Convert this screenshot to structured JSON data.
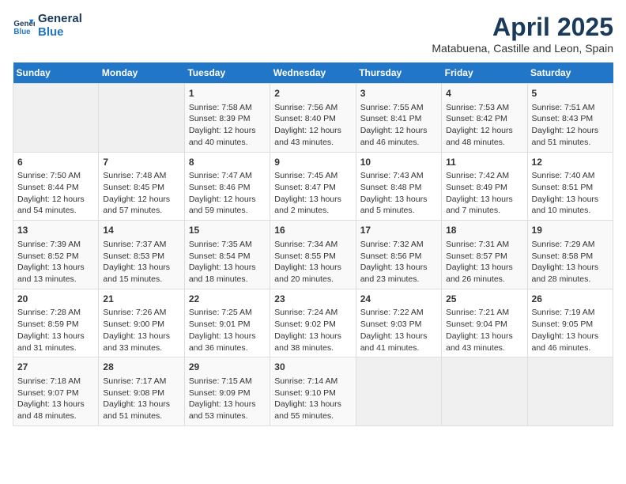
{
  "logo": {
    "line1": "General",
    "line2": "Blue"
  },
  "title": "April 2025",
  "subtitle": "Matabuena, Castille and Leon, Spain",
  "days_of_week": [
    "Sunday",
    "Monday",
    "Tuesday",
    "Wednesday",
    "Thursday",
    "Friday",
    "Saturday"
  ],
  "weeks": [
    [
      {
        "day": "",
        "info": ""
      },
      {
        "day": "",
        "info": ""
      },
      {
        "day": "1",
        "info": "Sunrise: 7:58 AM\nSunset: 8:39 PM\nDaylight: 12 hours and 40 minutes."
      },
      {
        "day": "2",
        "info": "Sunrise: 7:56 AM\nSunset: 8:40 PM\nDaylight: 12 hours and 43 minutes."
      },
      {
        "day": "3",
        "info": "Sunrise: 7:55 AM\nSunset: 8:41 PM\nDaylight: 12 hours and 46 minutes."
      },
      {
        "day": "4",
        "info": "Sunrise: 7:53 AM\nSunset: 8:42 PM\nDaylight: 12 hours and 48 minutes."
      },
      {
        "day": "5",
        "info": "Sunrise: 7:51 AM\nSunset: 8:43 PM\nDaylight: 12 hours and 51 minutes."
      }
    ],
    [
      {
        "day": "6",
        "info": "Sunrise: 7:50 AM\nSunset: 8:44 PM\nDaylight: 12 hours and 54 minutes."
      },
      {
        "day": "7",
        "info": "Sunrise: 7:48 AM\nSunset: 8:45 PM\nDaylight: 12 hours and 57 minutes."
      },
      {
        "day": "8",
        "info": "Sunrise: 7:47 AM\nSunset: 8:46 PM\nDaylight: 12 hours and 59 minutes."
      },
      {
        "day": "9",
        "info": "Sunrise: 7:45 AM\nSunset: 8:47 PM\nDaylight: 13 hours and 2 minutes."
      },
      {
        "day": "10",
        "info": "Sunrise: 7:43 AM\nSunset: 8:48 PM\nDaylight: 13 hours and 5 minutes."
      },
      {
        "day": "11",
        "info": "Sunrise: 7:42 AM\nSunset: 8:49 PM\nDaylight: 13 hours and 7 minutes."
      },
      {
        "day": "12",
        "info": "Sunrise: 7:40 AM\nSunset: 8:51 PM\nDaylight: 13 hours and 10 minutes."
      }
    ],
    [
      {
        "day": "13",
        "info": "Sunrise: 7:39 AM\nSunset: 8:52 PM\nDaylight: 13 hours and 13 minutes."
      },
      {
        "day": "14",
        "info": "Sunrise: 7:37 AM\nSunset: 8:53 PM\nDaylight: 13 hours and 15 minutes."
      },
      {
        "day": "15",
        "info": "Sunrise: 7:35 AM\nSunset: 8:54 PM\nDaylight: 13 hours and 18 minutes."
      },
      {
        "day": "16",
        "info": "Sunrise: 7:34 AM\nSunset: 8:55 PM\nDaylight: 13 hours and 20 minutes."
      },
      {
        "day": "17",
        "info": "Sunrise: 7:32 AM\nSunset: 8:56 PM\nDaylight: 13 hours and 23 minutes."
      },
      {
        "day": "18",
        "info": "Sunrise: 7:31 AM\nSunset: 8:57 PM\nDaylight: 13 hours and 26 minutes."
      },
      {
        "day": "19",
        "info": "Sunrise: 7:29 AM\nSunset: 8:58 PM\nDaylight: 13 hours and 28 minutes."
      }
    ],
    [
      {
        "day": "20",
        "info": "Sunrise: 7:28 AM\nSunset: 8:59 PM\nDaylight: 13 hours and 31 minutes."
      },
      {
        "day": "21",
        "info": "Sunrise: 7:26 AM\nSunset: 9:00 PM\nDaylight: 13 hours and 33 minutes."
      },
      {
        "day": "22",
        "info": "Sunrise: 7:25 AM\nSunset: 9:01 PM\nDaylight: 13 hours and 36 minutes."
      },
      {
        "day": "23",
        "info": "Sunrise: 7:24 AM\nSunset: 9:02 PM\nDaylight: 13 hours and 38 minutes."
      },
      {
        "day": "24",
        "info": "Sunrise: 7:22 AM\nSunset: 9:03 PM\nDaylight: 13 hours and 41 minutes."
      },
      {
        "day": "25",
        "info": "Sunrise: 7:21 AM\nSunset: 9:04 PM\nDaylight: 13 hours and 43 minutes."
      },
      {
        "day": "26",
        "info": "Sunrise: 7:19 AM\nSunset: 9:05 PM\nDaylight: 13 hours and 46 minutes."
      }
    ],
    [
      {
        "day": "27",
        "info": "Sunrise: 7:18 AM\nSunset: 9:07 PM\nDaylight: 13 hours and 48 minutes."
      },
      {
        "day": "28",
        "info": "Sunrise: 7:17 AM\nSunset: 9:08 PM\nDaylight: 13 hours and 51 minutes."
      },
      {
        "day": "29",
        "info": "Sunrise: 7:15 AM\nSunset: 9:09 PM\nDaylight: 13 hours and 53 minutes."
      },
      {
        "day": "30",
        "info": "Sunrise: 7:14 AM\nSunset: 9:10 PM\nDaylight: 13 hours and 55 minutes."
      },
      {
        "day": "",
        "info": ""
      },
      {
        "day": "",
        "info": ""
      },
      {
        "day": "",
        "info": ""
      }
    ]
  ]
}
